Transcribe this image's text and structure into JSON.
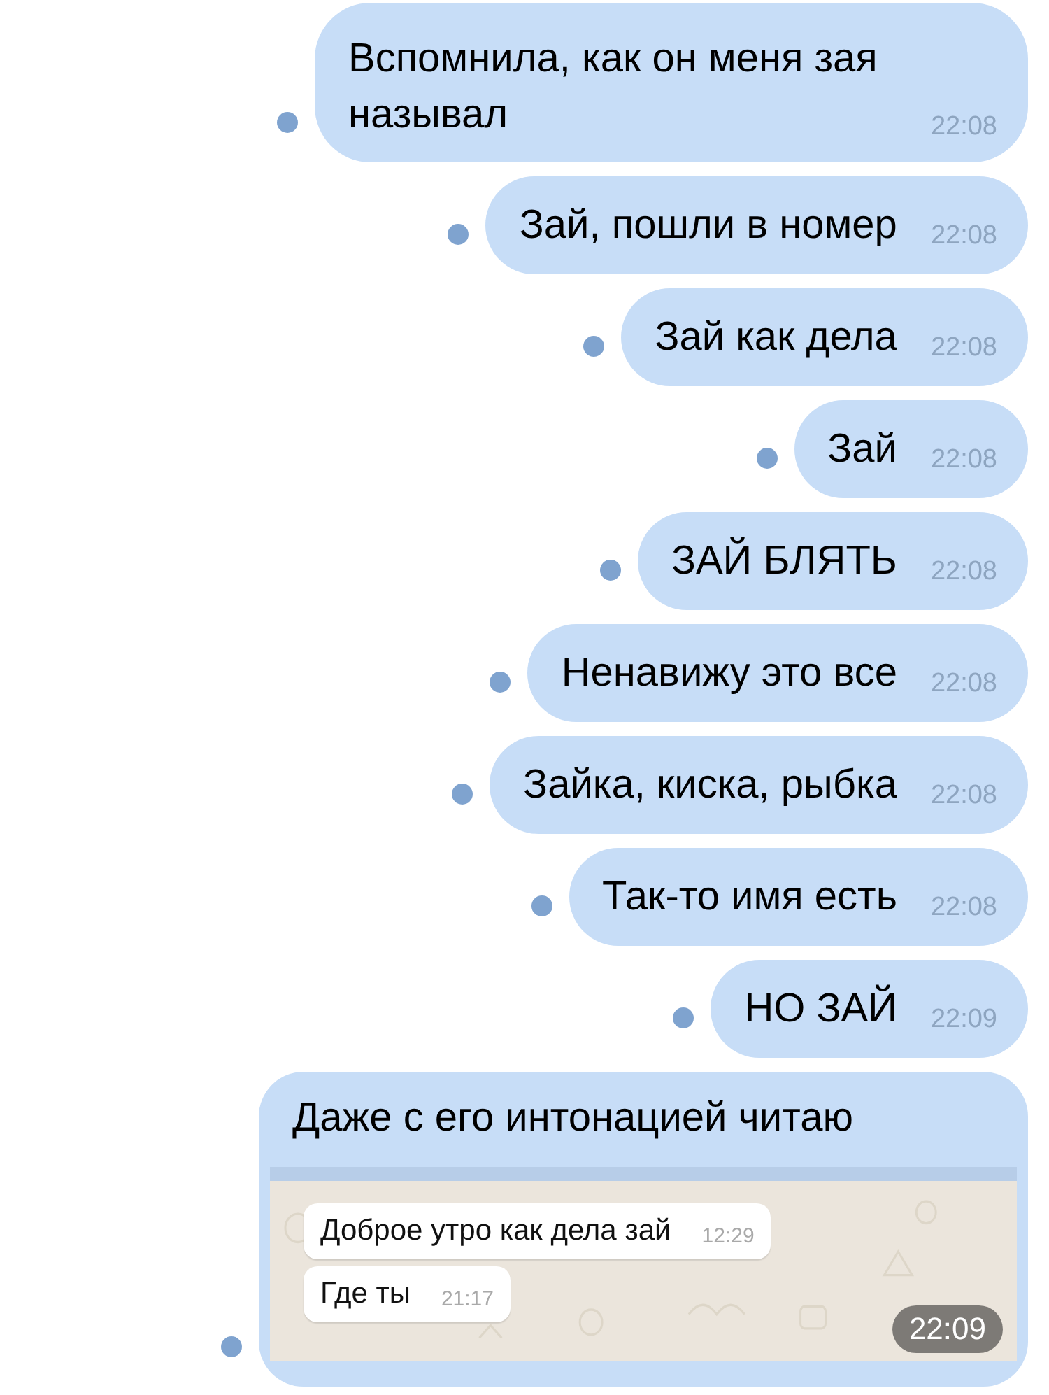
{
  "messages": [
    {
      "kind": "text",
      "text": "Вспомнила, как он меня зая называл",
      "time": "22:08",
      "unread": true
    },
    {
      "kind": "text",
      "text": "Зай, пошли в номер",
      "time": "22:08",
      "unread": true
    },
    {
      "kind": "text",
      "text": "Зай как дела",
      "time": "22:08",
      "unread": true
    },
    {
      "kind": "text",
      "text": "Зай",
      "time": "22:08",
      "unread": true
    },
    {
      "kind": "text",
      "text": "ЗАЙ БЛЯТЬ",
      "time": "22:08",
      "unread": true
    },
    {
      "kind": "text",
      "text": "Ненавижу это все",
      "time": "22:08",
      "unread": true
    },
    {
      "kind": "text",
      "text": "Зайка, киска, рыбка",
      "time": "22:08",
      "unread": true
    },
    {
      "kind": "text",
      "text": "Так-то имя есть",
      "time": "22:08",
      "unread": true
    },
    {
      "kind": "text",
      "text": "НО ЗАЙ",
      "time": "22:09",
      "unread": true
    },
    {
      "kind": "screenshot",
      "text": "Даже с его интонацией читаю",
      "time": "22:09",
      "unread": true,
      "screenshot": {
        "messages": [
          {
            "text": "Доброе утро как дела зай",
            "time": "12:29"
          },
          {
            "text": "Где ты",
            "time": "21:17"
          }
        ]
      }
    }
  ]
}
